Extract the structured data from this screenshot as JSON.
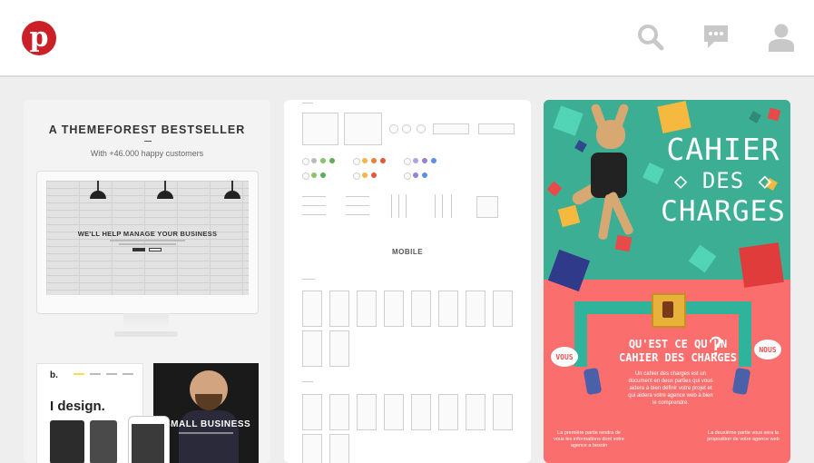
{
  "header": {
    "logo_letter": "p",
    "brand_color": "#cb2027",
    "icons": [
      "search-icon",
      "messages-icon",
      "profile-icon"
    ]
  },
  "pins": [
    {
      "title": "A THEMEFOREST BESTSELLER",
      "subtitle": "With +46.000 happy customers",
      "screen_headline": "WE'LL HELP MANAGE YOUR BUSINESS",
      "thumb_brand": "b.",
      "thumb_heading": "I design.",
      "thumb_banner": "SMALL BUSINESS"
    },
    {
      "section_label": "MOBILE"
    },
    {
      "title_line1": "CAHIER",
      "title_line2": "◇ DES ◇",
      "title_line3": "CHARGES",
      "question": "QU'EST CE QU'UN CAHIER DES CHARGES",
      "question_mark": "?",
      "bubble_left": "VOUS",
      "bubble_right": "NOUS",
      "description": "Un cahier des charges est un document en deux parties qui vous aidera à bien définir votre projet et qui aidera votre agence web à bien le comprendre.",
      "footer_left": "La première partie rendra de vous les informations dont votre agence a besoin",
      "footer_right": "La deuxième partie vous sera la proposition de votre agence web"
    }
  ]
}
